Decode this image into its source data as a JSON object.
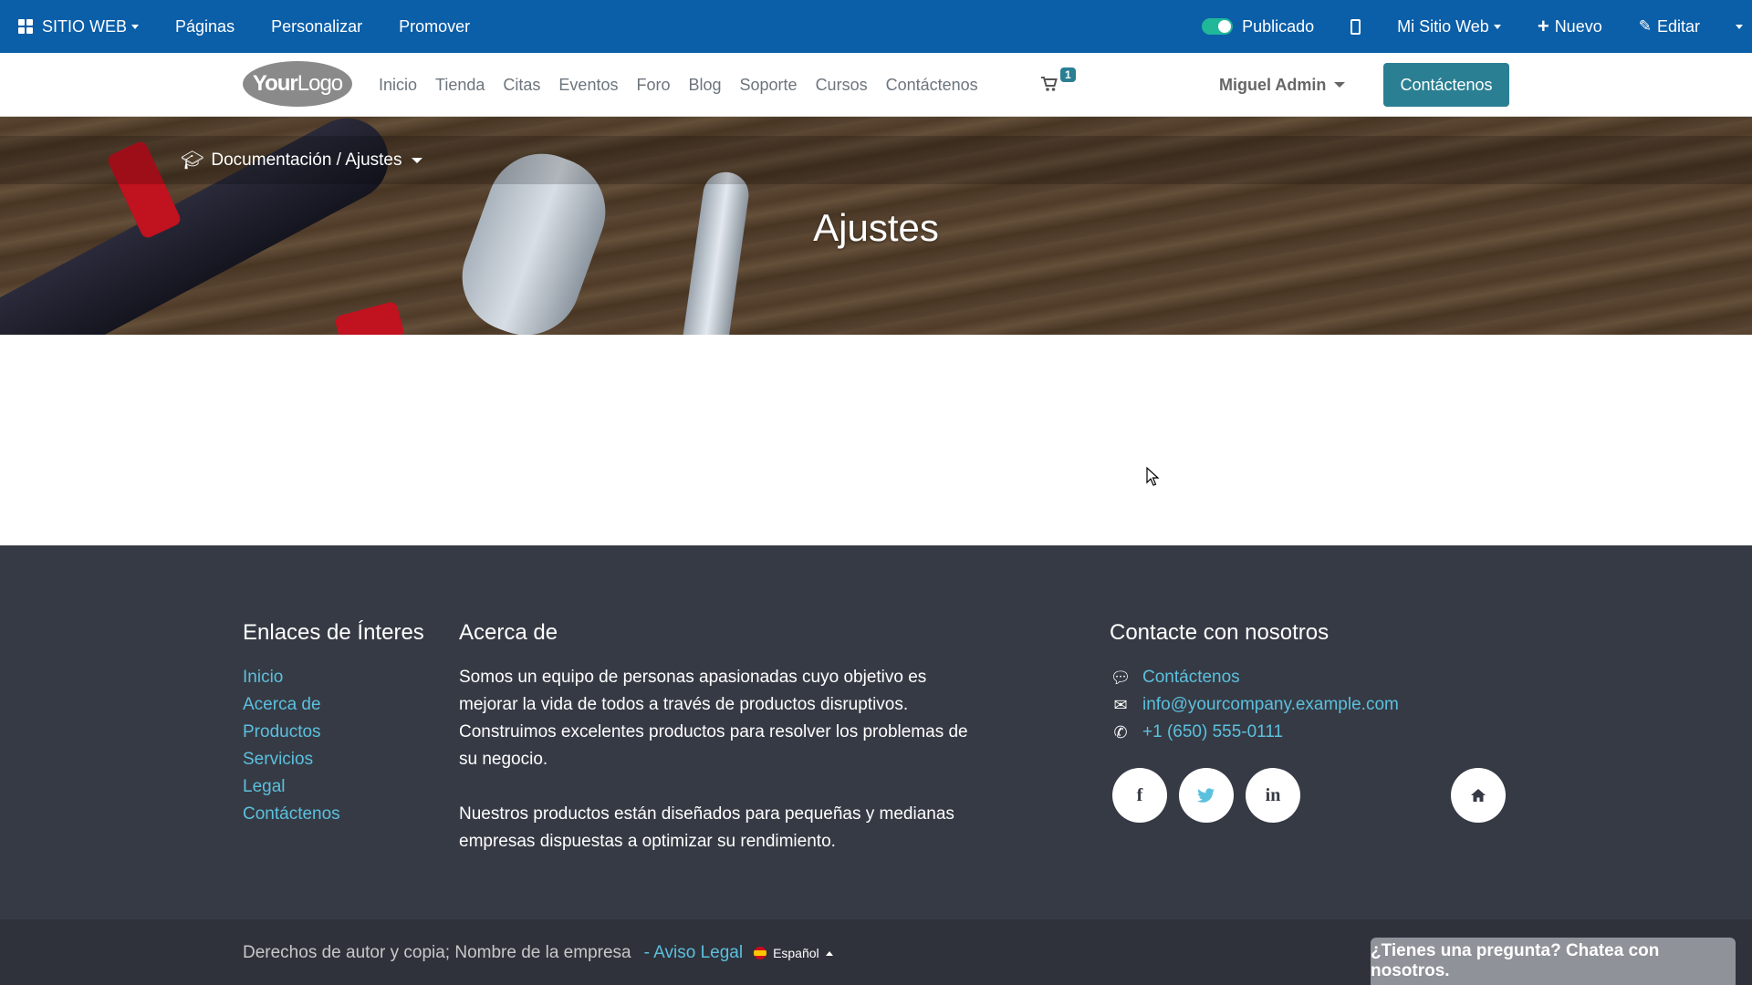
{
  "admin_bar": {
    "app_menu": "SITIO WEB",
    "pages": "Páginas",
    "customize": "Personalizar",
    "promote": "Promover",
    "published": "Publicado",
    "website_switcher": "Mi Sitio Web",
    "new": "Nuevo",
    "edit": "Editar"
  },
  "header": {
    "logo_bold": "Your",
    "logo_light": "Logo",
    "nav": [
      "Inicio",
      "Tienda",
      "Citas",
      "Eventos",
      "Foro",
      "Blog",
      "Soporte",
      "Cursos",
      "Contáctenos"
    ],
    "cart_count": "1",
    "user": "Miguel Admin",
    "cta": "Contáctenos"
  },
  "hero": {
    "breadcrumb": "Documentación / Ajustes",
    "title": "Ajustes"
  },
  "footer": {
    "links_title": "Enlaces de Ínteres",
    "links": [
      "Inicio",
      "Acerca de",
      "Productos",
      "Servicios",
      "Legal",
      "Contáctenos"
    ],
    "about_title": "Acerca de",
    "about_p1": "Somos un equipo de personas apasionadas cuyo objetivo es mejorar la vida de todos a través de productos disruptivos. Construimos excelentes productos para resolver los problemas de su negocio.",
    "about_p2": "Nuestros productos están diseñados para pequeñas y medianas empresas dispuestas a optimizar su rendimiento.",
    "contact_title": "Contacte con nosotros",
    "contact_link": "Contáctenos",
    "email": "info@yourcompany.example.com",
    "phone": "+1 (650) 555-0111",
    "social": {
      "facebook": "f",
      "twitter": "t",
      "linkedin": "in"
    }
  },
  "copyright": {
    "text": "Derechos de autor y copia; Nombre de la empresa",
    "legal": "- Aviso Legal",
    "language": "Español"
  },
  "chat": {
    "label": "¿Tienes una pregunta? Chatea con nosotros."
  },
  "colors": {
    "admin_bar": "#0b5ea8",
    "accent": "#2a7f93",
    "footer_bg": "#363a44",
    "link": "#5bc0de"
  }
}
